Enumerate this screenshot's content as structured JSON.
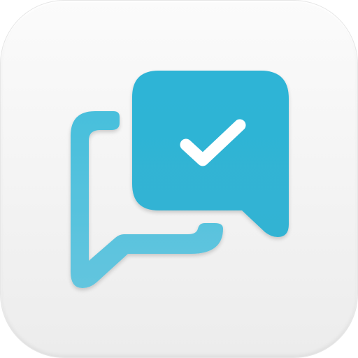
{
  "app_icon": {
    "symbol": "chat-bubbles-check-icon",
    "colors": {
      "tile_background": "#f3f3f3",
      "accent": "#4cc0dc",
      "accent_dark": "#2fb0d2",
      "check_mark": "#ffffff"
    }
  }
}
